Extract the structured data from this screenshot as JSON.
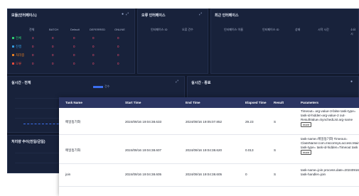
{
  "status_panel": {
    "title": "모듈(인터페이스)",
    "icons": [
      "circle-icon",
      "expand-icon"
    ],
    "headers": [
      "전체",
      "BATCH",
      "Default",
      "DEFERRED",
      "ONLINE"
    ],
    "rows": [
      {
        "label": "전체",
        "color": "#2ecc71",
        "values": [
          "3",
          "0",
          "0",
          "0",
          "0"
        ]
      },
      {
        "label": "진행",
        "color": "#3498db",
        "values": [
          "0",
          "0",
          "0",
          "0",
          "0"
        ]
      },
      {
        "label": "처리중",
        "color": "#e67e22",
        "values": [
          "0",
          "0",
          "0",
          "0",
          "0"
        ]
      },
      {
        "label": "오류",
        "color": "#e74c3c",
        "values": [
          "0",
          "0",
          "0",
          "0",
          "0"
        ]
      }
    ]
  },
  "error_panel": {
    "title": "오류 인터페이스",
    "headers": [
      "인터페이스 ID",
      "오류 건수"
    ]
  },
  "exec_panel": {
    "title": "최근 인터페이스",
    "headers": [
      "인터페이스 이름",
      "인터페이스 ID",
      "상태",
      "시작 시간",
      "소요시"
    ]
  },
  "realtime_all": {
    "title": "실시간 - 전체",
    "legend": "건수"
  },
  "realtime_detail": {
    "title": "실시간 - 종료"
  },
  "weekly": {
    "title": "처리량 추이(전일/금일)"
  },
  "colors": {
    "dashboard_bg": "#121a2e",
    "panel_bg": "#18223b",
    "modal_header": "#2b3562",
    "value_red": "#ff4d6d"
  },
  "modal": {
    "headers": {
      "task_name": "Task Name",
      "start_time": "Start Time",
      "end_time": "End Time",
      "elapsed": "Elapsed Time",
      "result": "Result",
      "params": "Parameters"
    },
    "rows": [
      {
        "task_name": "메일동기화",
        "start_time": "2024/09/16 19:04:38.633",
        "end_time": "2024/09/16 19:05:07.852",
        "elapsed": "29.23",
        "result": "S",
        "params": "Timeout= arg-value-3-false task-type= task-id-hidden-arg-value-2 out-ResultValue=SynchedList arg-name",
        "more": "more"
      },
      {
        "task_name": "메일동기화",
        "start_time": "2024/09/16 19:04:38.607",
        "end_time": "2024/09/16 19:04:38.620",
        "elapsed": "0.013",
        "result": "S",
        "params": "task-name=메일동기화 Timeout= ClassName:com.mscorreys.access.Main task-type= task-id-hidden=Timeout task",
        "more": "more"
      },
      {
        "task_name": "join",
        "start_time": "2024/09/16 19:04:38.605",
        "end_time": "2024/09/16 19:04:38.605",
        "elapsed": "0",
        "result": "S",
        "params": "task-name=join process.date=20240916 task-handler=join",
        "more": ""
      }
    ]
  }
}
